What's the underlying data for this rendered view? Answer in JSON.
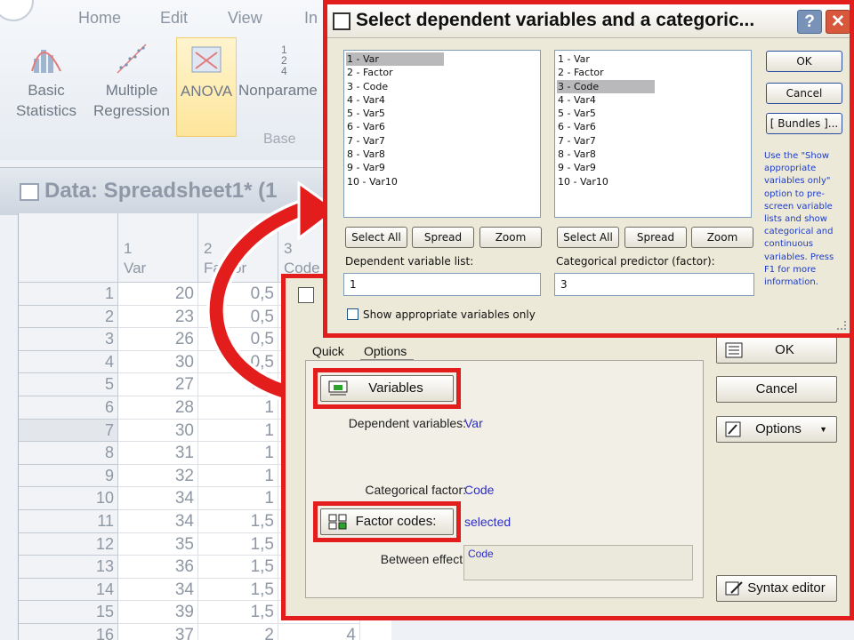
{
  "ribbon": {
    "tabs": [
      "Home",
      "Edit",
      "View",
      "In"
    ],
    "buttons": [
      {
        "line1": "Basic",
        "line2": "Statistics"
      },
      {
        "line1": "Multiple",
        "line2": "Regression"
      },
      {
        "line1": "ANOVA",
        "line2": ""
      },
      {
        "line1": "Nonparame",
        "line2": ""
      }
    ],
    "group_label": "Base"
  },
  "spreadsheet": {
    "title": "Data: Spreadsheet1* (1",
    "columns": [
      {
        "num": "1",
        "name": "Var"
      },
      {
        "num": "2",
        "name": "Factor"
      },
      {
        "num": "3",
        "name": "Code"
      }
    ],
    "rows": [
      {
        "n": "1",
        "var": "20",
        "factor": "0,5",
        "code": ""
      },
      {
        "n": "2",
        "var": "23",
        "factor": "0,5",
        "code": ""
      },
      {
        "n": "3",
        "var": "26",
        "factor": "0,5",
        "code": ""
      },
      {
        "n": "4",
        "var": "30",
        "factor": "0,5",
        "code": ""
      },
      {
        "n": "5",
        "var": "27",
        "factor": "0,5",
        "code": ""
      },
      {
        "n": "6",
        "var": "28",
        "factor": "1",
        "code": ""
      },
      {
        "n": "7",
        "var": "30",
        "factor": "1",
        "code": ""
      },
      {
        "n": "8",
        "var": "31",
        "factor": "1",
        "code": ""
      },
      {
        "n": "9",
        "var": "32",
        "factor": "1",
        "code": ""
      },
      {
        "n": "10",
        "var": "34",
        "factor": "1",
        "code": ""
      },
      {
        "n": "11",
        "var": "34",
        "factor": "1,5",
        "code": ""
      },
      {
        "n": "12",
        "var": "35",
        "factor": "1,5",
        "code": ""
      },
      {
        "n": "13",
        "var": "36",
        "factor": "1,5",
        "code": ""
      },
      {
        "n": "14",
        "var": "34",
        "factor": "1,5",
        "code": ""
      },
      {
        "n": "15",
        "var": "39",
        "factor": "1,5",
        "code": ""
      },
      {
        "n": "16",
        "var": "37",
        "factor": "2",
        "code": "4"
      }
    ]
  },
  "main_dialog": {
    "tabs": [
      "Quick",
      "Options"
    ],
    "variables_button": "Variables",
    "dependent_label": "Dependent variables:",
    "dependent_value": "Var",
    "categorical_label": "Categorical factor:",
    "categorical_value": "Code",
    "factor_codes_button": "Factor codes:",
    "factor_codes_value": "selected",
    "between_label": "Between effect:",
    "between_value": "Code",
    "ok": "OK",
    "cancel": "Cancel",
    "options": "Options",
    "options_arrow": "▼",
    "syntax_editor": "Syntax editor"
  },
  "select_dialog": {
    "title": "Select dependent variables and a categoric...",
    "help_button": "?",
    "close_button": "✕",
    "variables": [
      "1 - Var",
      "2 - Factor",
      "3 - Code",
      "4 - Var4",
      "5 - Var5",
      "6 - Var6",
      "7 - Var7",
      "8 - Var8",
      "9 - Var9",
      "10 - Var10"
    ],
    "select_all": "Select All",
    "spread": "Spread",
    "zoom": "Zoom",
    "dependent_list_label": "Dependent variable list:",
    "dependent_list_value": "1",
    "categorical_label": "Categorical predictor (factor):",
    "categorical_value": "3",
    "ok": "OK",
    "cancel": "Cancel",
    "bundles": "[ Bundles ]...",
    "help_text": "Use the \"Show appropriate variables only\" option to pre-screen variable lists and show categorical and continuous variables. Press F1 for more information.",
    "show_appropriate_label": "Show appropriate variables only"
  },
  "colors": {
    "highlight_red": "#e31c1c",
    "value_blue": "#2d2dc8"
  }
}
